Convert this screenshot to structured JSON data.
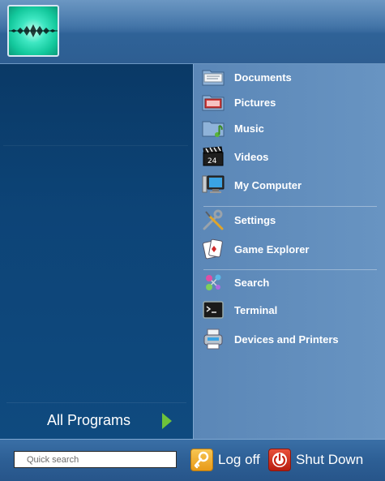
{
  "user": {
    "avatar_icon": "mirrored-waveform-avatar"
  },
  "left": {
    "all_programs_label": "All Programs",
    "all_programs_icon": "green-arrow-right-icon"
  },
  "right": {
    "items": [
      {
        "label": "Documents",
        "icon": "folder-documents-icon"
      },
      {
        "label": "Pictures",
        "icon": "folder-pictures-icon"
      },
      {
        "label": "Music",
        "icon": "folder-music-icon"
      },
      {
        "label": "Videos",
        "icon": "film-clapper-icon"
      },
      {
        "label": "My Computer",
        "icon": "computer-monitor-icon"
      },
      {
        "label": "Settings",
        "icon": "wrench-screwdriver-icon"
      },
      {
        "label": "Game Explorer",
        "icon": "playing-cards-icon"
      },
      {
        "label": "Search",
        "icon": "search-network-icon"
      },
      {
        "label": "Terminal",
        "icon": "terminal-icon"
      },
      {
        "label": "Devices and Printers",
        "icon": "devices-printers-icon"
      }
    ]
  },
  "bottom": {
    "search_placeholder": "Quick search",
    "logoff_label": "Log off",
    "logoff_icon": "key-icon",
    "shutdown_label": "Shut Down",
    "shutdown_icon": "power-icon"
  },
  "colors": {
    "left_pane": "#0d4477",
    "right_pane": "#6894c2",
    "arrow_green": "#6ec23b",
    "shutdown_red": "#d23a26",
    "logoff_orange": "#f0b23a"
  }
}
